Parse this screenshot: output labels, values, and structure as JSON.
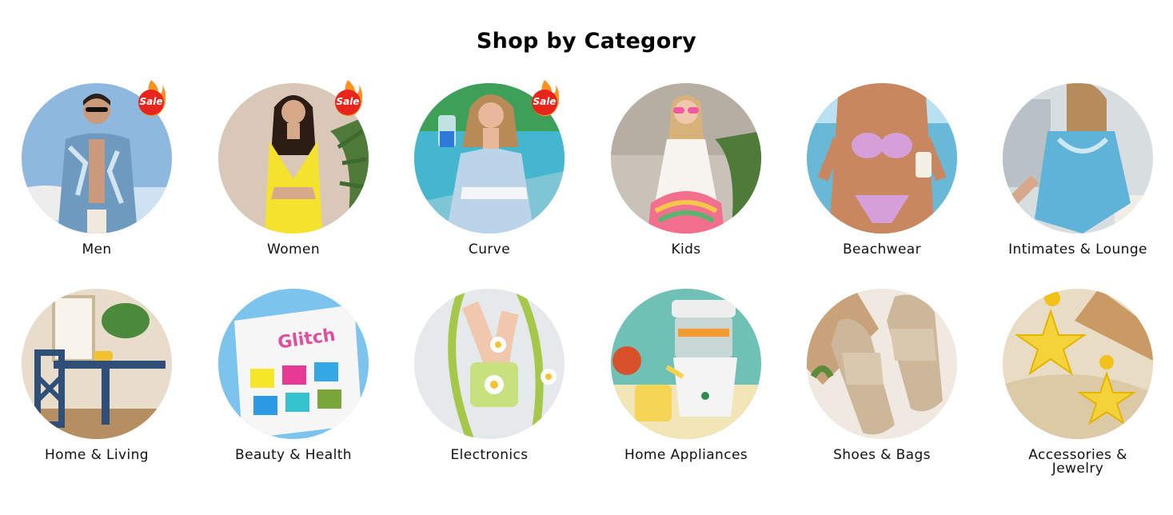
{
  "section_title": "Shop by Category",
  "badge_text": "Sale",
  "categories": [
    {
      "label": "Men",
      "sale": true,
      "icon": "men-photo",
      "bg": "#8fb8de"
    },
    {
      "label": "Women",
      "sale": true,
      "icon": "women-photo",
      "bg": "#d9c8b8"
    },
    {
      "label": "Curve",
      "sale": true,
      "icon": "curve-photo",
      "bg": "#7ec6d6"
    },
    {
      "label": "Kids",
      "sale": false,
      "icon": "kids-photo",
      "bg": "#c9c2b8"
    },
    {
      "label": "Beachwear",
      "sale": false,
      "icon": "beachwear-photo",
      "bg": "#6ab8d8"
    },
    {
      "label": "Intimates & Lounge",
      "sale": false,
      "icon": "intimates-photo",
      "bg": "#d8dde0"
    },
    {
      "label": "Home & Living",
      "sale": false,
      "icon": "home-living-photo",
      "bg": "#e8dccb"
    },
    {
      "label": "Beauty & Health",
      "sale": false,
      "icon": "beauty-photo",
      "bg": "#7cc3ee"
    },
    {
      "label": "Electronics",
      "sale": false,
      "icon": "electronics-photo",
      "bg": "#e6e9ec"
    },
    {
      "label": "Home Appliances",
      "sale": false,
      "icon": "appliances-photo",
      "bg": "#6fc1b6"
    },
    {
      "label": "Shoes & Bags",
      "sale": false,
      "icon": "shoes-bags-photo",
      "bg": "#efe9e1"
    },
    {
      "label": "Accessories & Jewelry",
      "label_line1": "Accessories &",
      "label_line2": "Jewelry",
      "sale": false,
      "icon": "accessories-photo",
      "bg": "#e9dcc5"
    }
  ],
  "colors": {
    "sale_badge": "#e8251c",
    "flame": "#f7931e",
    "title_text": "#000000",
    "label_text": "#111111"
  }
}
